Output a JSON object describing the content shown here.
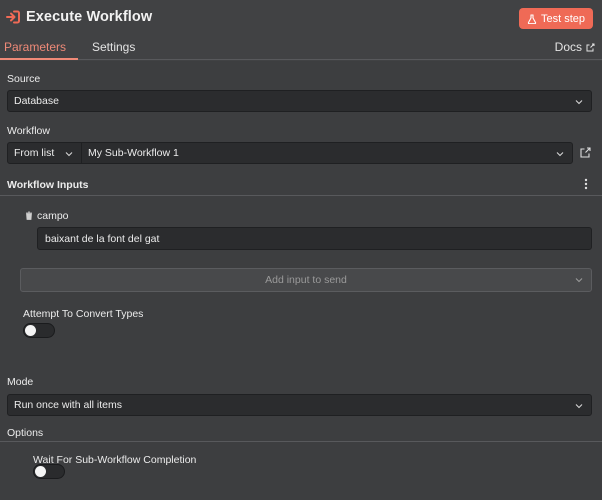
{
  "header": {
    "title": "Execute Workflow",
    "test_step_label": "Test step"
  },
  "tabs": {
    "parameters": "Parameters",
    "settings": "Settings",
    "docs": "Docs"
  },
  "source": {
    "label": "Source",
    "value": "Database"
  },
  "workflow": {
    "label": "Workflow",
    "mode_value": "From list",
    "selected_value": "My Sub-Workflow 1"
  },
  "workflow_inputs": {
    "label": "Workflow Inputs",
    "field_name": "campo",
    "field_value": "baixant de la font del gat",
    "add_input_placeholder": "Add input to send",
    "convert_types_label": "Attempt To Convert Types",
    "convert_types_enabled": false
  },
  "mode": {
    "label": "Mode",
    "value": "Run once with all items"
  },
  "options": {
    "label": "Options",
    "wait_label": "Wait For Sub-Workflow Completion",
    "wait_enabled": false
  },
  "colors": {
    "accent": "#ef6a56",
    "background": "#414244",
    "field": "#2b2c2e"
  }
}
